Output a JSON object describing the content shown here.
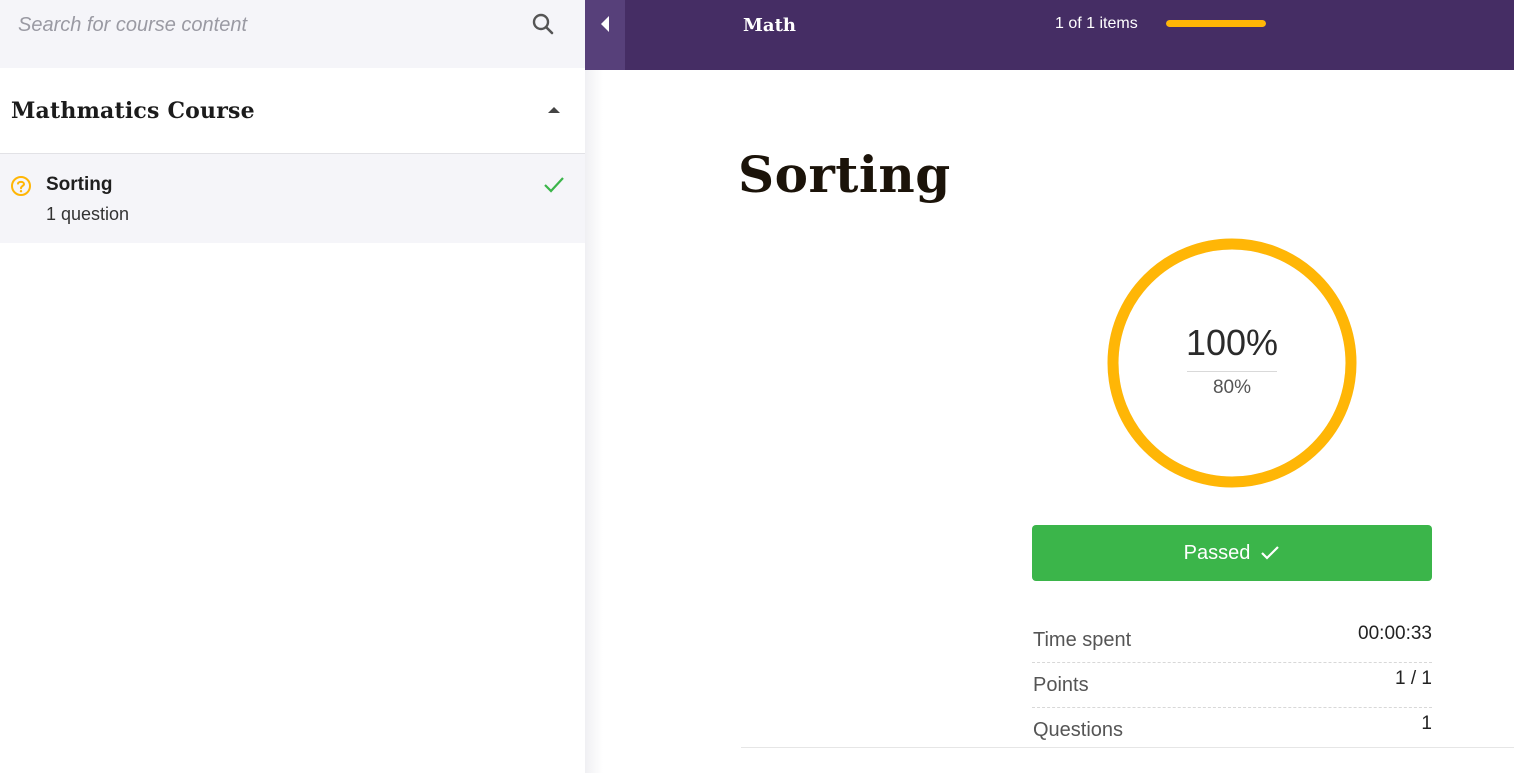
{
  "sidebar": {
    "search": {
      "placeholder": "Search for course content",
      "icon": "search-icon"
    },
    "course_title": "Mathmatics Course",
    "lessons": [
      {
        "title": "Sorting",
        "subtitle": "1 question",
        "icon": "question-circle-icon",
        "status": "completed"
      }
    ]
  },
  "header": {
    "course_name": "Math",
    "items_count": "1 of 1 items",
    "progress_fraction": 1.0,
    "colors": {
      "background": "#452d64",
      "accent": "#ffb606"
    }
  },
  "main": {
    "title": "Sorting",
    "result": {
      "score": "100%",
      "passing_grade": "80%",
      "score_fraction": 1.0,
      "ring_color": "#ffb606"
    },
    "status_button": {
      "label": "Passed",
      "color": "#3bb54a"
    },
    "stats": [
      {
        "label": "Time spent",
        "value": "00:00:33"
      },
      {
        "label": "Points",
        "value": "1 / 1"
      },
      {
        "label": "Questions",
        "value": "1"
      }
    ]
  }
}
